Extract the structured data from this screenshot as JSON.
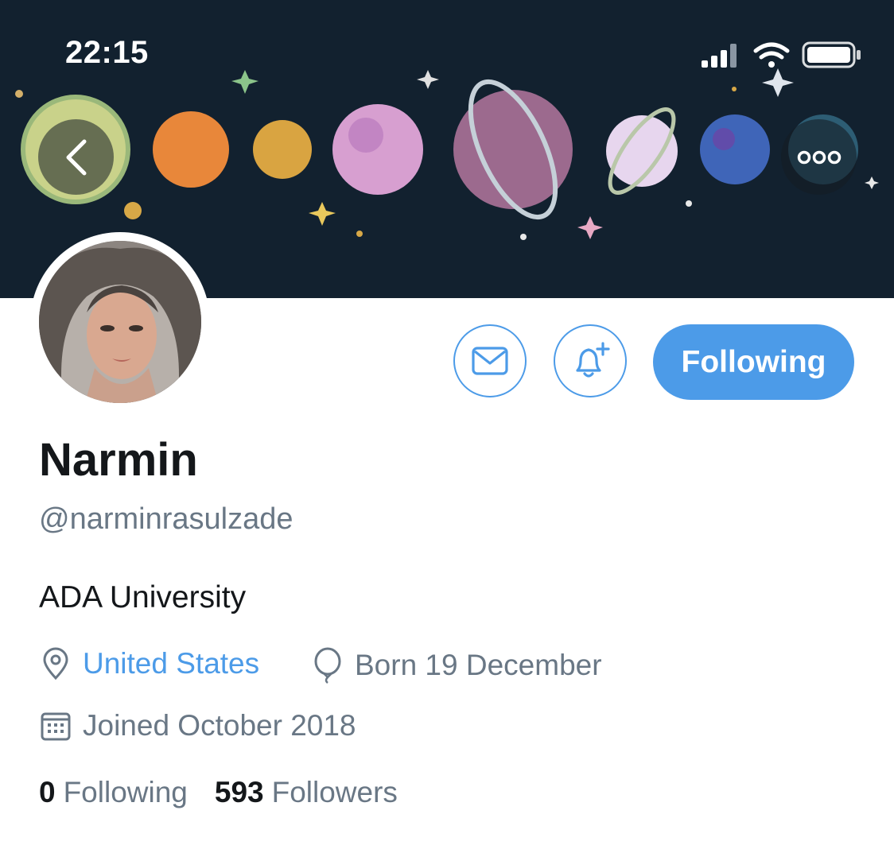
{
  "status_bar": {
    "time": "22:15"
  },
  "banner": {
    "background_color": "#12212f"
  },
  "toolbar": {
    "back_icon": "chevron-left-icon",
    "more_icon": "more-horizontal-icon"
  },
  "actions": {
    "message_icon": "mail-icon",
    "notify_icon": "bell-plus-icon",
    "follow_label": "Following",
    "accent_color": "#4c9be8"
  },
  "profile": {
    "name": "Narmin",
    "handle": "@narminrasulzade",
    "bio": "ADA University",
    "location": "United States",
    "birthday": "Born 19 December",
    "joined": "Joined October 2018"
  },
  "stats": {
    "following_count": "0",
    "following_label": "Following",
    "followers_count": "593",
    "followers_label": "Followers"
  }
}
